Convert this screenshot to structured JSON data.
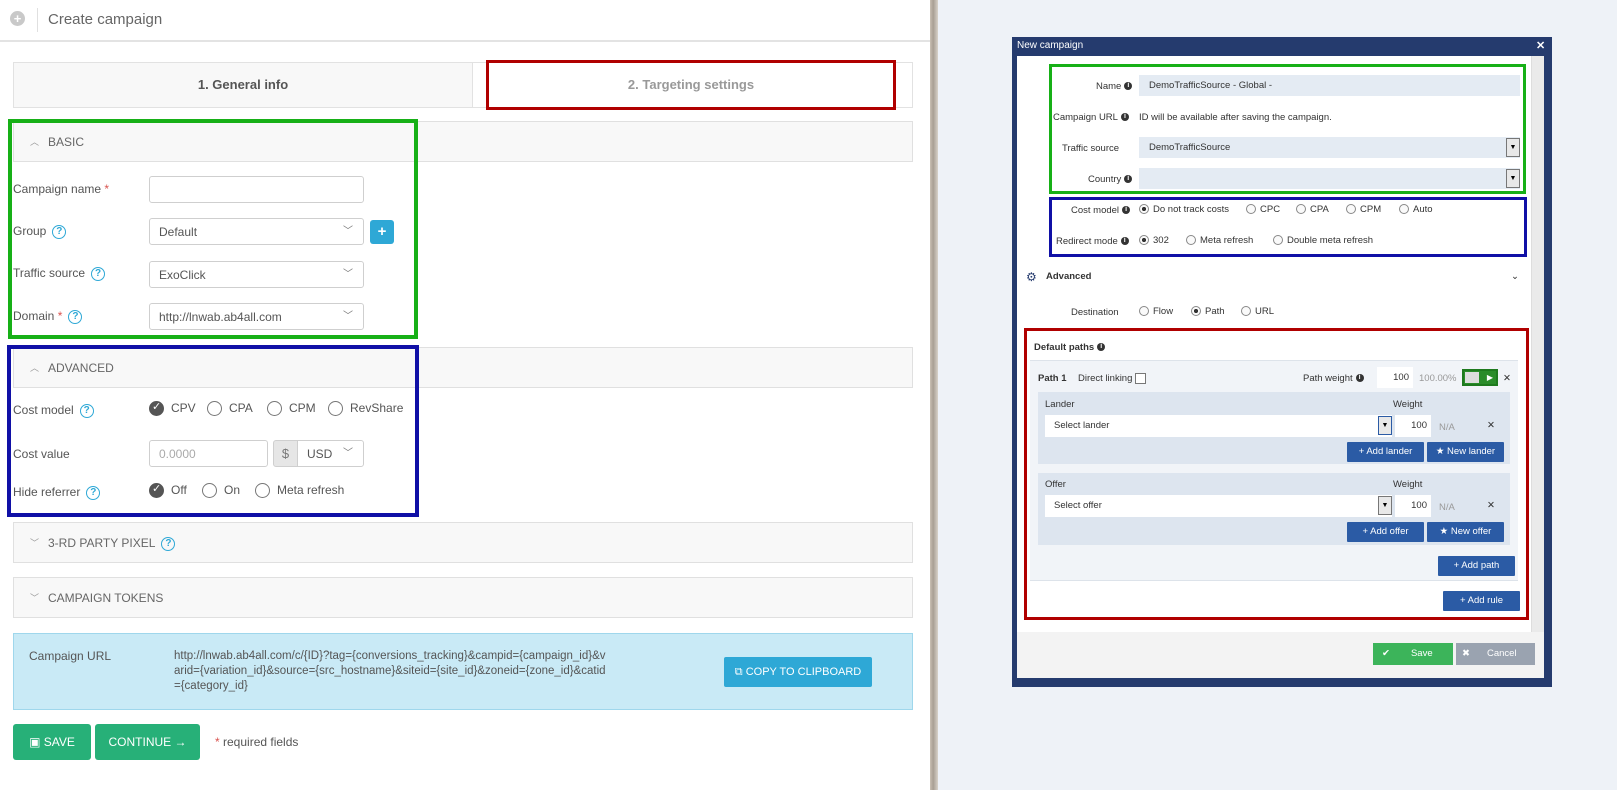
{
  "left": {
    "title": "Create campaign",
    "steps": [
      "1. General info",
      "2. Targeting settings"
    ],
    "basic": {
      "header": "BASIC",
      "campaign_name_label": "Campaign name",
      "campaign_name_value": "",
      "group_label": "Group",
      "group_value": "Default",
      "traffic_source_label": "Traffic source",
      "traffic_source_value": "ExoClick",
      "domain_label": "Domain",
      "domain_value": "http://lnwab.ab4all.com"
    },
    "advanced": {
      "header": "ADVANCED",
      "cost_model_label": "Cost model",
      "cost_models": [
        "CPV",
        "CPA",
        "CPM",
        "RevShare"
      ],
      "cost_model_selected": "CPV",
      "cost_value_label": "Cost value",
      "cost_value_placeholder": "0.0000",
      "currency_symbol": "$",
      "currency": "USD",
      "hide_referrer_label": "Hide referrer",
      "hide_referrer_options": [
        "Off",
        "On",
        "Meta refresh"
      ],
      "hide_referrer_selected": "Off"
    },
    "pixel_header": "3-RD PARTY PIXEL",
    "tokens_header": "CAMPAIGN TOKENS",
    "campaign_url_label": "Campaign URL",
    "campaign_url_lines": [
      "http://lnwab.ab4all.com/c/{ID}?tag={conversions_tracking}&campid={campaign_id}&v",
      "arid={variation_id}&source={src_hostname}&siteid={site_id}&zoneid={zone_id}&catid",
      "={category_id}"
    ],
    "copy_button": "COPY TO CLIPBOARD",
    "save_button": "SAVE",
    "continue_button": "CONTINUE →",
    "required_note": "required fields"
  },
  "right": {
    "title": "New campaign",
    "name_label": "Name",
    "name_value": "DemoTrafficSource - Global -",
    "url_label": "Campaign URL",
    "url_value": "ID will be available after saving the campaign.",
    "traffic_source_label": "Traffic source",
    "traffic_source_value": "DemoTrafficSource",
    "country_label": "Country",
    "country_value": "",
    "cost_model_label": "Cost model",
    "cost_models": [
      "Do not track costs",
      "CPC",
      "CPA",
      "CPM",
      "Auto"
    ],
    "redirect_label": "Redirect mode",
    "redirect_modes": [
      "302",
      "Meta refresh",
      "Double meta refresh"
    ],
    "advanced_label": "Advanced",
    "destination_label": "Destination",
    "destinations": [
      "Flow",
      "Path",
      "URL"
    ],
    "default_paths": "Default paths",
    "path_label": "Path 1",
    "direct_linking": "Direct linking",
    "path_weight_label": "Path weight",
    "path_weight_value": "100",
    "path_weight_pct": "100.00%",
    "lander_label": "Lander",
    "weight_label": "Weight",
    "select_lander": "Select lander",
    "lander_weight": "100",
    "na": "N/A",
    "add_lander": "+ Add lander",
    "new_lander": "★ New lander",
    "offer_label": "Offer",
    "select_offer": "Select offer",
    "offer_weight": "100",
    "add_offer": "+ Add offer",
    "new_offer": "★ New offer",
    "add_path": "+ Add path",
    "add_rule": "+ Add rule",
    "save": "Save",
    "cancel": "Cancel"
  },
  "colors": {
    "green_highlight": "#17b017",
    "blue_highlight": "#1010a6",
    "red_highlight": "#b00000",
    "accent": "#2ea8d6",
    "button_green": "#27b078"
  }
}
